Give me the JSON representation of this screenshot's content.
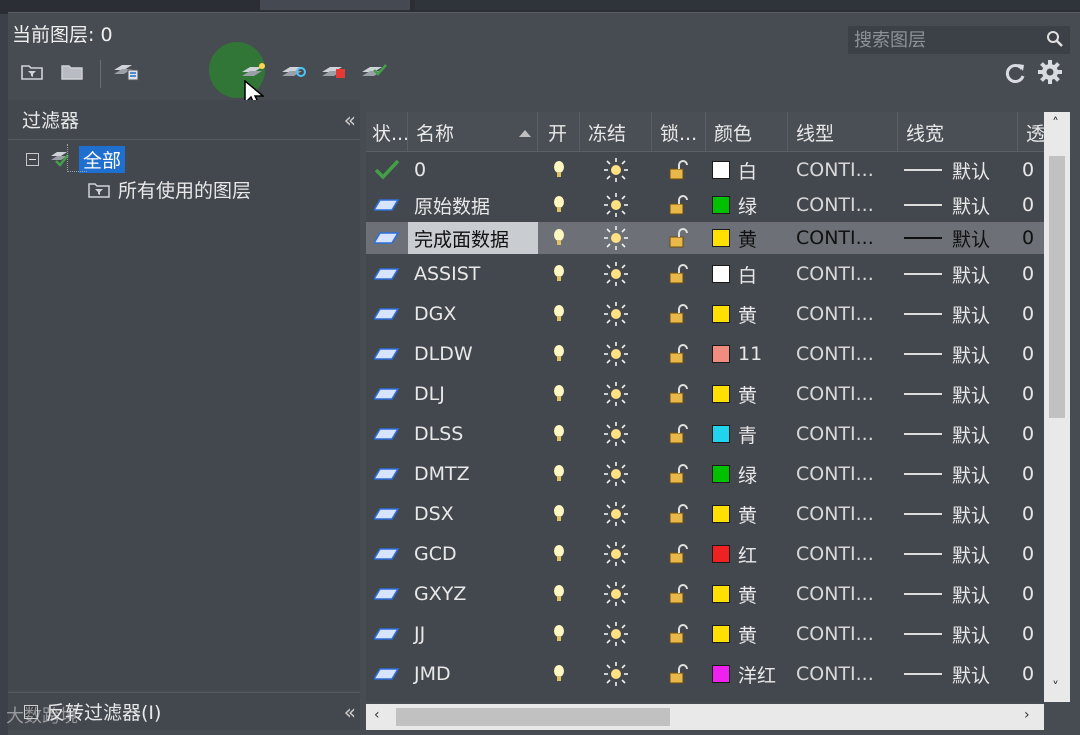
{
  "header": {
    "current_layer": "当前图层: 0",
    "search_placeholder": "搜索图层"
  },
  "toolbar": {
    "left_icons": [
      "new-property-filter-icon",
      "new-group-filter-icon",
      "layer-states-manager-icon",
      "new-layer-icon",
      "new-layer-vp-frozen-icon",
      "delete-layer-icon",
      "set-current-icon"
    ],
    "right_icons": [
      "refresh-icon",
      "settings-icon"
    ]
  },
  "filters": {
    "title": "过滤器",
    "root_label": "全部",
    "child_label": "所有使用的图层",
    "invert_label": "反转过滤器(I)"
  },
  "watermark": "大数跨境",
  "table": {
    "columns": [
      "状...",
      "名称",
      "开",
      "冻结",
      "锁...",
      "颜色",
      "线型",
      "线宽",
      "透"
    ],
    "rows": [
      {
        "state": "current",
        "name": "0",
        "color_hex": "#ffffff",
        "color_name": "白",
        "linetype": "CONTI...",
        "lineweight": "默认",
        "trans": "0",
        "selected": false
      },
      {
        "state": "layer",
        "name": "原始数据",
        "color_hex": "#00c000",
        "color_name": "绿",
        "linetype": "CONTI...",
        "lineweight": "默认",
        "trans": "0",
        "selected": false
      },
      {
        "state": "layer",
        "name": "完成面数据",
        "color_hex": "#ffe000",
        "color_name": "黄",
        "linetype": "CONTI...",
        "lineweight": "默认",
        "trans": "0",
        "selected": true
      },
      {
        "state": "layer",
        "name": "ASSIST",
        "color_hex": "#ffffff",
        "color_name": "白",
        "linetype": "CONTI...",
        "lineweight": "默认",
        "trans": "0",
        "selected": false
      },
      {
        "state": "layer",
        "name": "DGX",
        "color_hex": "#ffe000",
        "color_name": "黄",
        "linetype": "CONTI...",
        "lineweight": "默认",
        "trans": "0",
        "selected": false
      },
      {
        "state": "layer",
        "name": "DLDW",
        "color_hex": "#f08c80",
        "color_name": "11",
        "linetype": "CONTI...",
        "lineweight": "默认",
        "trans": "0",
        "selected": false
      },
      {
        "state": "layer",
        "name": "DLJ",
        "color_hex": "#ffe000",
        "color_name": "黄",
        "linetype": "CONTI...",
        "lineweight": "默认",
        "trans": "0",
        "selected": false
      },
      {
        "state": "layer",
        "name": "DLSS",
        "color_hex": "#22d3ee",
        "color_name": "青",
        "linetype": "CONTI...",
        "lineweight": "默认",
        "trans": "0",
        "selected": false
      },
      {
        "state": "layer",
        "name": "DMTZ",
        "color_hex": "#00c000",
        "color_name": "绿",
        "linetype": "CONTI...",
        "lineweight": "默认",
        "trans": "0",
        "selected": false
      },
      {
        "state": "layer",
        "name": "DSX",
        "color_hex": "#ffe000",
        "color_name": "黄",
        "linetype": "CONTI...",
        "lineweight": "默认",
        "trans": "0",
        "selected": false
      },
      {
        "state": "layer",
        "name": "GCD",
        "color_hex": "#ee2222",
        "color_name": "红",
        "linetype": "CONTI...",
        "lineweight": "默认",
        "trans": "0",
        "selected": false
      },
      {
        "state": "layer",
        "name": "GXYZ",
        "color_hex": "#ffe000",
        "color_name": "黄",
        "linetype": "CONTI...",
        "lineweight": "默认",
        "trans": "0",
        "selected": false
      },
      {
        "state": "layer",
        "name": "JJ",
        "color_hex": "#ffe000",
        "color_name": "黄",
        "linetype": "CONTI...",
        "lineweight": "默认",
        "trans": "0",
        "selected": false
      },
      {
        "state": "layer",
        "name": "JMD",
        "color_hex": "#ee22ee",
        "color_name": "洋红",
        "linetype": "CONTI...",
        "lineweight": "默认",
        "trans": "0",
        "selected": false
      }
    ]
  }
}
